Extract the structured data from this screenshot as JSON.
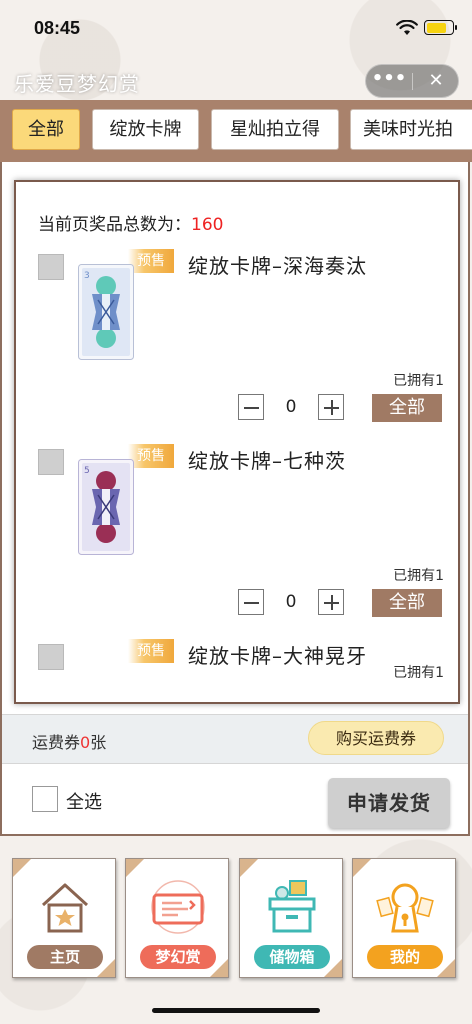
{
  "status_bar": {
    "time": "08:45",
    "battery_level": 0.8
  },
  "title_bar": {
    "title": "乐爱豆梦幻赏",
    "more_label": "•••",
    "close_label": "✕"
  },
  "tabs": [
    {
      "label": "全部",
      "active": true
    },
    {
      "label": "绽放卡牌",
      "active": false
    },
    {
      "label": "星灿拍立得",
      "active": false
    },
    {
      "label": "美味时光拍",
      "active": false
    }
  ],
  "list": {
    "count_label": "当前页奖品总数为：",
    "count_value": "160",
    "items": [
      {
        "presale": "预售",
        "name": "绽放卡牌–深海奏汰",
        "owned": "已拥有1",
        "qty": "0",
        "all_label": "全部",
        "card_number": "3",
        "hair_color": "#5fc9b8",
        "card_color": "#6f8fc9"
      },
      {
        "presale": "预售",
        "name": "绽放卡牌–七种茨",
        "owned": "已拥有1",
        "qty": "0",
        "all_label": "全部",
        "card_number": "5",
        "hair_color": "#9a2f55",
        "card_color": "#6a66b0"
      },
      {
        "presale": "预售",
        "name": "绽放卡牌–大神晃牙",
        "owned": "已拥有1"
      }
    ]
  },
  "shipping": {
    "prefix": "运费券",
    "count": "0",
    "suffix": "张",
    "buy_label": "购买运费券"
  },
  "footer": {
    "select_all_label": "全选",
    "apply_label": "申请发货"
  },
  "nav": [
    {
      "label": "主页",
      "icon": "home-icon",
      "color": "#a07a64"
    },
    {
      "label": "梦幻赏",
      "icon": "ticket-icon",
      "color": "#ee6c5a"
    },
    {
      "label": "储物箱",
      "icon": "storage-box-icon",
      "color": "#3fb8b4"
    },
    {
      "label": "我的",
      "icon": "profile-keyhole-icon",
      "color": "#f3a21f"
    }
  ],
  "colors": {
    "tab_strip": "#a9826c",
    "accent_red": "#e22222",
    "all_button": "#a07a64"
  }
}
